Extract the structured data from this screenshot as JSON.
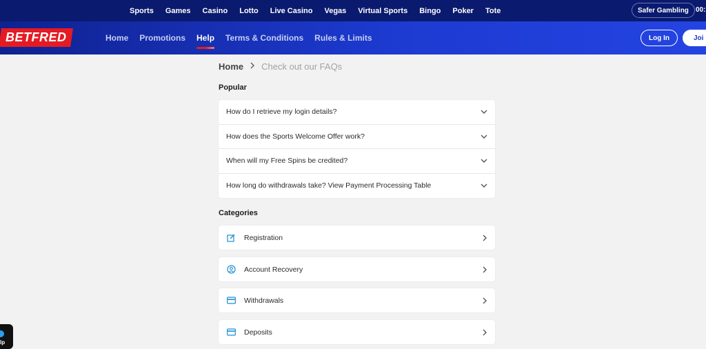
{
  "topnav": {
    "items": [
      "Sports",
      "Games",
      "Casino",
      "Lotto",
      "Live Casino",
      "Vegas",
      "Virtual Sports",
      "Bingo",
      "Poker",
      "Tote"
    ],
    "safer_gambling": "Safer Gambling",
    "clock": "00:"
  },
  "header": {
    "logo_text": "BETFRED",
    "nav": [
      "Home",
      "Promotions",
      "Help",
      "Terms & Conditions",
      "Rules & Limits"
    ],
    "active_nav": "Help",
    "login_label": "Log In",
    "join_label": "Joi"
  },
  "breadcrumb": {
    "home": "Home",
    "current": "Check out our FAQs"
  },
  "popular": {
    "title": "Popular",
    "questions": [
      "How do I retrieve my login details?",
      "How does the Sports Welcome Offer work?",
      "When will my Free Spins be credited?",
      "How long do withdrawals take? View Payment Processing Table"
    ]
  },
  "categories": {
    "title": "Categories",
    "items": [
      {
        "label": "Registration",
        "icon": "edit-icon"
      },
      {
        "label": "Account Recovery",
        "icon": "user-circle-icon"
      },
      {
        "label": "Withdrawals",
        "icon": "card-icon"
      },
      {
        "label": "Deposits",
        "icon": "card-icon"
      }
    ]
  },
  "help_widget": {
    "label": "lp"
  },
  "colors": {
    "brand_red": "#e41b23",
    "nav_blue": "#1d3ad0",
    "top_blue": "#0a1a6e",
    "icon_blue": "#1b8fd2"
  }
}
